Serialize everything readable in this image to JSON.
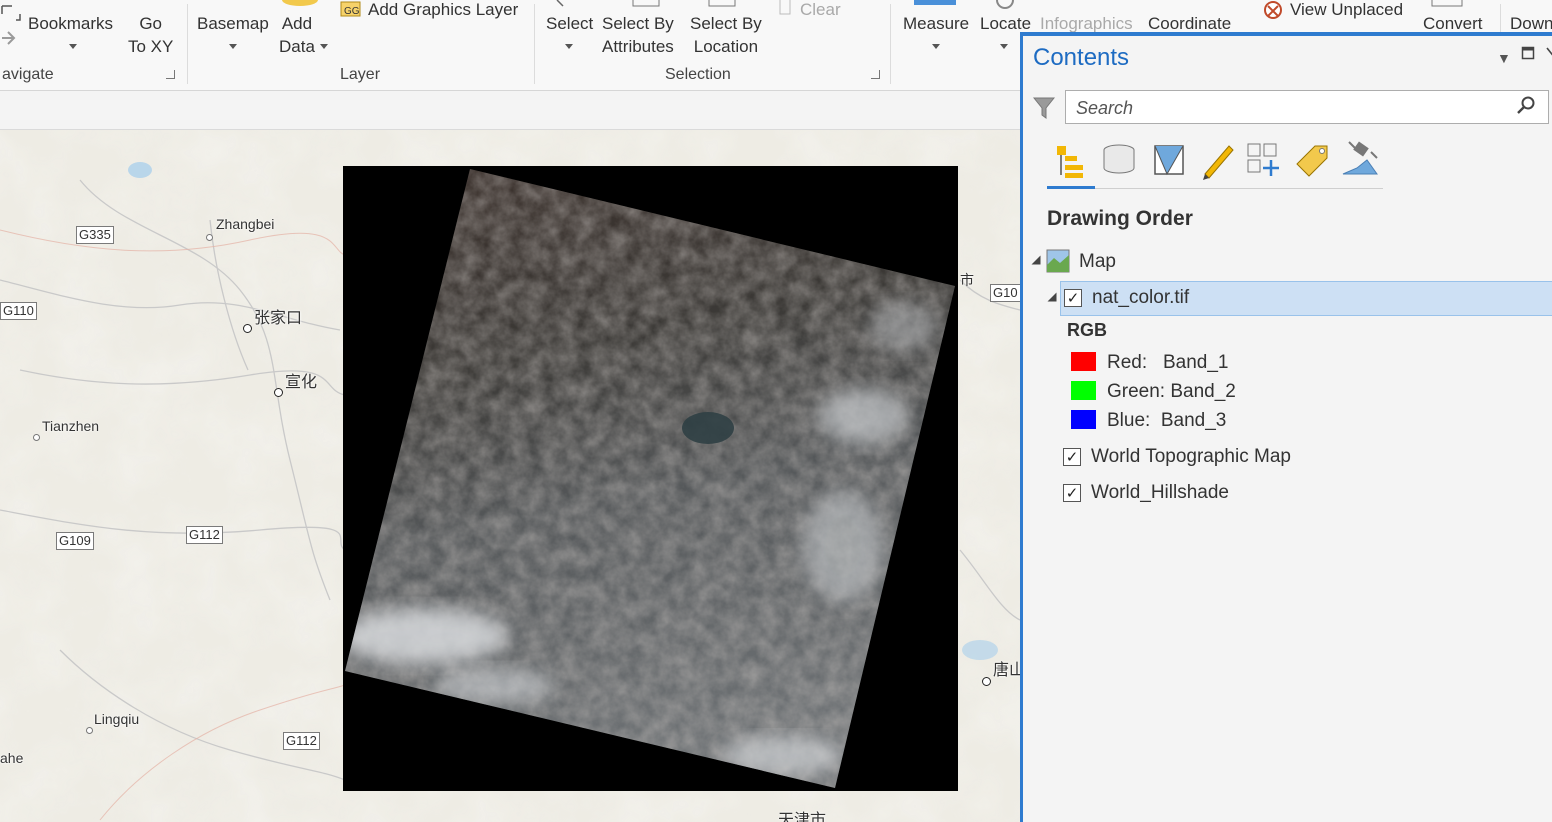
{
  "ribbon": {
    "navigate": {
      "bookmarks": "Bookmarks",
      "go_to_xy_line1": "Go",
      "go_to_xy_line2": "To XY",
      "group_label": "avigate"
    },
    "layer": {
      "basemap": "Basemap",
      "add_data_line1": "Add",
      "add_data_line2": "Data",
      "add_graphics_layer": "Add Graphics Layer",
      "group_label": "Layer"
    },
    "selection": {
      "select": "Select",
      "select_by_attributes_line1": "Select By",
      "select_by_attributes_line2": "Attributes",
      "select_by_location_line1": "Select By",
      "select_by_location_line2": "Location",
      "clear": "Clear",
      "group_label": "Selection"
    },
    "inquiry": {
      "measure": "Measure",
      "locate": "Locate",
      "infographics": "Infographics",
      "coordinate": "Coordinate"
    },
    "labeling": {
      "view_unplaced": "View Unplaced",
      "convert": "Convert",
      "download": "Down"
    }
  },
  "map": {
    "labels": {
      "zhangbei": "Zhangbei",
      "zhangjiakou": "张家口",
      "xuanhua": "宣化",
      "tianzhen": "Tianzhen",
      "lingqiu": "Lingqiu",
      "ahe": "ahe",
      "tianjin": "天津市",
      "tangshan": "唐山",
      "partial_city": "市"
    },
    "shields": {
      "g335": "G335",
      "g110": "G110",
      "g109": "G109",
      "g112_a": "G112",
      "g112_b": "G112",
      "g10": "G10"
    }
  },
  "contents": {
    "title": "Contents",
    "search": {
      "placeholder": "Search"
    },
    "tabs": [
      "list-by-drawing-order",
      "list-by-source",
      "list-by-selection",
      "list-by-editing",
      "list-by-snapping",
      "list-by-labeling",
      "list-by-perspective-imagery"
    ],
    "drawing_order_heading": "Drawing Order",
    "map_node": "Map",
    "layers": [
      {
        "name": "nat_color.tif",
        "checked": true,
        "selected": true
      },
      {
        "name": "World Topographic Map",
        "checked": true
      },
      {
        "name": "World_Hillshade",
        "checked": true
      }
    ],
    "rgb": {
      "heading": "RGB",
      "bands": [
        {
          "label": "Red:   Band_1",
          "color": "#ff0000"
        },
        {
          "label": "Green: Band_2",
          "color": "#00ff00"
        },
        {
          "label": "Blue:  Band_3",
          "color": "#0000ff"
        }
      ]
    }
  }
}
